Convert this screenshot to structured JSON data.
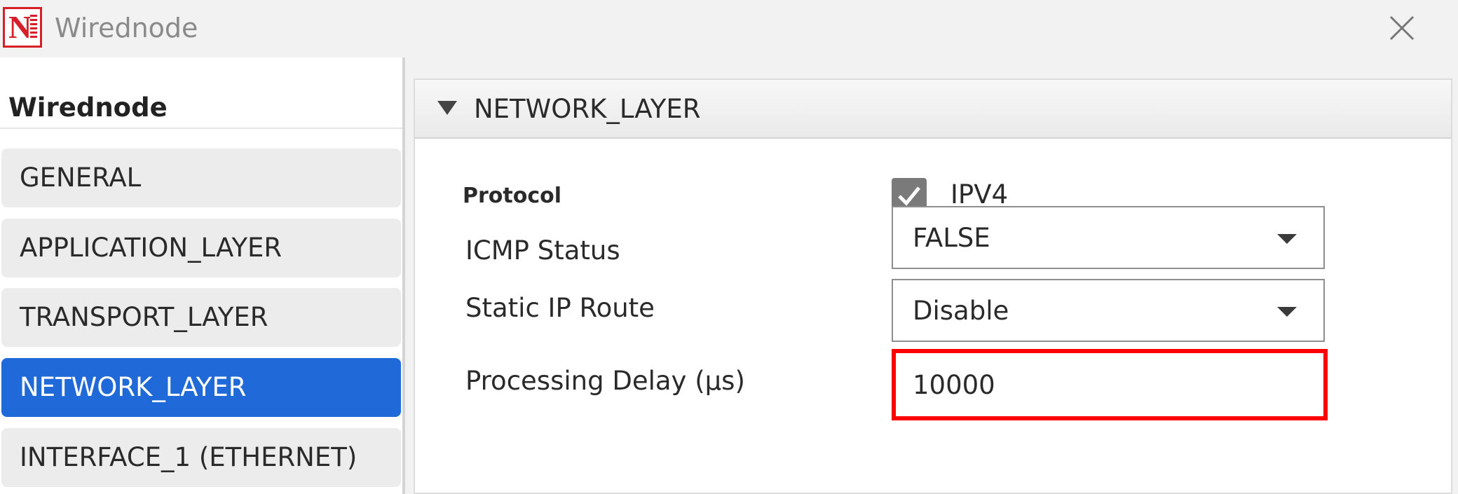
{
  "window": {
    "title": "Wirednode",
    "logo_icon": "netsim-logo-icon",
    "close_icon": "close-icon"
  },
  "sidebar": {
    "heading": "Wirednode",
    "items": [
      {
        "label": "GENERAL",
        "active": false
      },
      {
        "label": "APPLICATION_LAYER",
        "active": false
      },
      {
        "label": "TRANSPORT_LAYER",
        "active": false
      },
      {
        "label": "NETWORK_LAYER",
        "active": true
      },
      {
        "label": "INTERFACE_1 (ETHERNET)",
        "active": false
      }
    ]
  },
  "section": {
    "title": "NETWORK_LAYER",
    "collapse_icon": "triangle-down-icon",
    "fields": {
      "protocol": {
        "label": "Protocol",
        "checkbox_label": "IPV4",
        "checked": true
      },
      "icmp_status": {
        "label": "ICMP Status",
        "value": "FALSE"
      },
      "static_ip_route": {
        "label": "Static IP Route",
        "value": "Disable"
      },
      "processing_delay": {
        "label": "Processing Delay (µs)",
        "value": "10000"
      }
    }
  },
  "colors": {
    "active_nav": "#1f6ad8",
    "highlight_border": "#ff0000",
    "logo_red": "#d61f26"
  }
}
